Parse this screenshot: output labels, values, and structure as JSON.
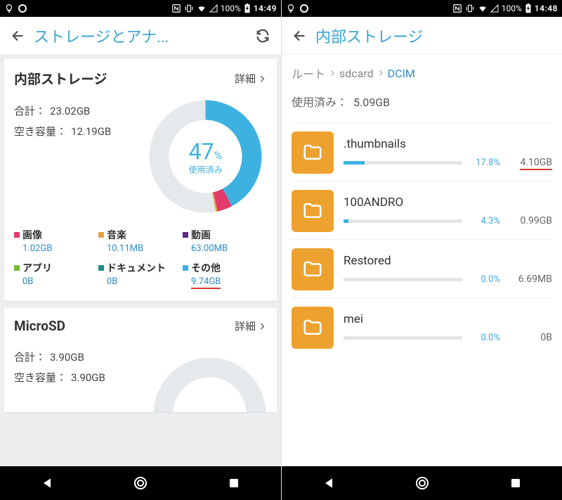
{
  "left": {
    "status": {
      "battery": "100%",
      "time": "14:49"
    },
    "title": "ストレージとアナ...",
    "internal": {
      "heading": "内部ストレージ",
      "detail": "詳細",
      "total_label": "合計：",
      "total_value": "23.02GB",
      "free_label": "空き容量：",
      "free_value": "12.19GB",
      "used_pct_num": "47",
      "used_pct_sym": "%",
      "used_label": "使用済み",
      "legend": [
        {
          "name": "画像",
          "value": "1.02GB",
          "color": "#e23b6a"
        },
        {
          "name": "音楽",
          "value": "10.11MB",
          "color": "#e9a23b"
        },
        {
          "name": "動画",
          "value": "63.00MB",
          "color": "#5b2a86"
        },
        {
          "name": "アプリ",
          "value": "0B",
          "color": "#7bb83a"
        },
        {
          "name": "ドキュメント",
          "value": "0B",
          "color": "#1f8a8a"
        },
        {
          "name": "その他",
          "value": "9.74GB",
          "color": "#3db2e0",
          "underline": true
        }
      ]
    },
    "microsd": {
      "heading": "MicroSD",
      "detail": "詳細",
      "total_label": "合計：",
      "total_value": "3.90GB",
      "free_label": "空き容量：",
      "free_value": "3.90GB"
    }
  },
  "right": {
    "status": {
      "battery": "100%",
      "time": "14:48"
    },
    "title": "内部ストレージ",
    "breadcrumb": {
      "root": "ルート",
      "mid": "sdcard",
      "leaf": "DCIM"
    },
    "used_label": "使用済み：",
    "used_value": "5.09GB",
    "folders": [
      {
        "name": ".thumbnails",
        "pct": "17.8%",
        "pct_num": 17.8,
        "size": "4.10GB",
        "underline": true
      },
      {
        "name": "100ANDRO",
        "pct": "4.3%",
        "pct_num": 4.3,
        "size": "0.99GB"
      },
      {
        "name": "Restored",
        "pct": "0.0%",
        "pct_num": 0,
        "size": "6.69MB"
      },
      {
        "name": "mei",
        "pct": "0.0%",
        "pct_num": 0,
        "size": "0B"
      }
    ]
  },
  "chart_data": {
    "type": "pie",
    "title": "内部ストレージ 使用済み 47%",
    "series": [
      {
        "name": "画像",
        "value": 1.02,
        "unit": "GB",
        "color": "#e23b6a"
      },
      {
        "name": "音楽",
        "value": 0.0099,
        "unit": "GB",
        "color": "#e9a23b"
      },
      {
        "name": "動画",
        "value": 0.0615,
        "unit": "GB",
        "color": "#5b2a86"
      },
      {
        "name": "アプリ",
        "value": 0,
        "unit": "GB",
        "color": "#7bb83a"
      },
      {
        "name": "ドキュメント",
        "value": 0,
        "unit": "GB",
        "color": "#1f8a8a"
      },
      {
        "name": "その他",
        "value": 9.74,
        "unit": "GB",
        "color": "#3db2e0"
      },
      {
        "name": "空き容量",
        "value": 12.19,
        "unit": "GB",
        "color": "#e5e9ec"
      }
    ],
    "total": 23.02,
    "used_percent": 47
  }
}
